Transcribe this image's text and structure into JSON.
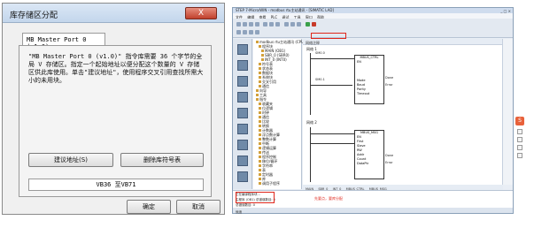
{
  "dialog": {
    "title": "库存储区分配",
    "close_label": "X",
    "tab_label": "MB Master Port 0 (v1.0)",
    "description": "\"MB Master Port 0 (v1.0)\" 指令库需要 36 个字节的全局 V 存储区。指定一个起始地址以便分配这个数量的 V 存储区供此库使用。单击\"建议地址\"，使用程序交叉引用查找所需大小的未用块。",
    "suggest_button": "建议地址(S)",
    "delete_button": "删除库符号表",
    "address_range": "VB36  至VB71",
    "ok_button": "确定",
    "cancel_button": "取消"
  },
  "ide": {
    "title": "STEP 7-Micro/WIN - modbus rtu主站通讯 - [SIMATIC LAD]",
    "window_buttons": "_ □ ×",
    "menu": [
      "文件",
      "编辑",
      "查看",
      "PLC",
      "调试",
      "工具",
      "窗口",
      "帮助"
    ],
    "tree_items": [
      "modbus rtu主站通讯 (CPU 224XP)",
      "程序块",
      "MAIN (OB1)",
      "SBR_0 (SBR0)",
      "INT_0 (INT0)",
      "符号表",
      "状态表",
      "数据块",
      "系统块",
      "交叉引用",
      "通信",
      "向导",
      "工具",
      "指令",
      "收藏夹",
      "位逻辑",
      "时钟",
      "通信",
      "比较",
      "转换",
      "计数器",
      "浮点数计算",
      "整数计算",
      "中断",
      "逻辑运算",
      "传送",
      "程序控制",
      "移位/循环",
      "字符串",
      "表",
      "定时器",
      "库",
      "调用子程序"
    ],
    "editor_header": "网络注释",
    "network1_label": "网络 1",
    "network2_label": "网络 2",
    "contact1": "SM0.0",
    "contact2": "SM0.1",
    "block1_title": "MBUS_CTRL",
    "block1_pins": [
      "EN",
      "Mode",
      "Baud",
      "Parity",
      "Timeout"
    ],
    "block1_outs": [
      "Done",
      "Error"
    ],
    "block2_title": "MBUS_MSG",
    "block2_pins": [
      "EN",
      "First",
      "Slave",
      "RW",
      "Addr",
      "Count",
      "DataPtr"
    ],
    "block2_outs": [
      "Done",
      "Error"
    ],
    "tabs": [
      "MAIN",
      "SBR_0",
      "INT_0",
      "MBUS_CTRL",
      "MBUS_MSG"
    ],
    "output_lines": [
      "正在编译程序块...",
      "主程序 (OB1) 总错误数目: 0",
      "总错误数目: 0"
    ],
    "status_text": "就绪",
    "note_top": "库存储区",
    "note_bottom": "先要点，要库分配",
    "badge": "S"
  },
  "colors": {
    "title_close": "#c0402d",
    "annotation_red": "#e0261b",
    "badge_orange": "#e8613a"
  }
}
